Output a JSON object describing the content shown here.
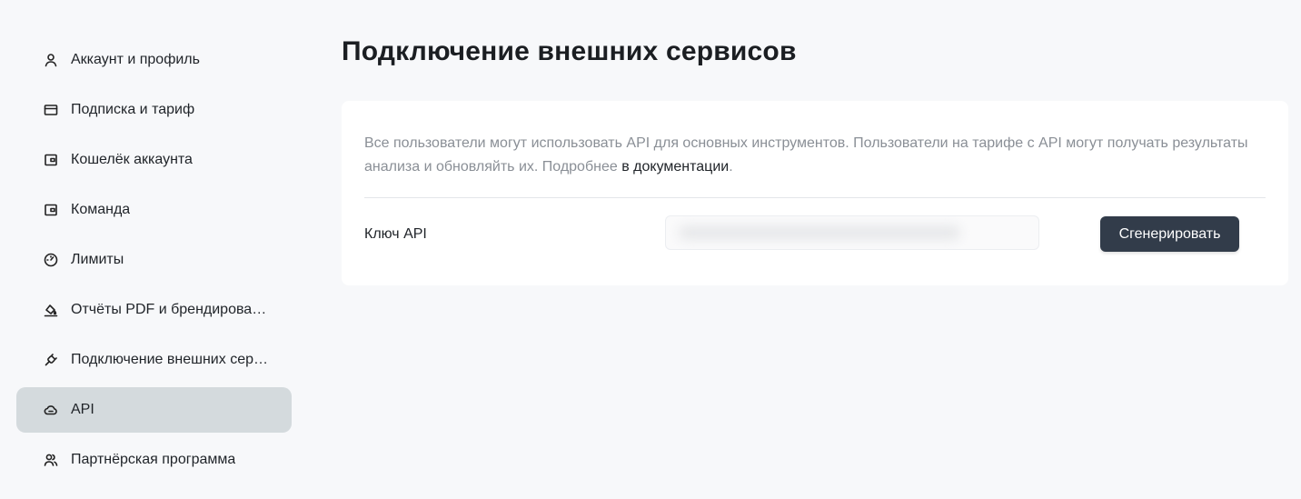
{
  "sidebar": {
    "items": [
      {
        "label": "Аккаунт и профиль",
        "icon": "user-icon",
        "active": false
      },
      {
        "label": "Подписка и тариф",
        "icon": "card-icon",
        "active": false
      },
      {
        "label": "Кошелёк аккаунта",
        "icon": "wallet-icon",
        "active": false
      },
      {
        "label": "Команда",
        "icon": "team-icon",
        "active": false
      },
      {
        "label": "Лимиты",
        "icon": "gauge-icon",
        "active": false
      },
      {
        "label": "Отчёты PDF и брендирова…",
        "icon": "paint-bucket-icon",
        "active": false
      },
      {
        "label": "Подключение внешних сер…",
        "icon": "plug-icon",
        "active": false
      },
      {
        "label": "API",
        "icon": "cloud-api-icon",
        "active": true
      },
      {
        "label": "Партнёрская программа",
        "icon": "partners-icon",
        "active": false
      }
    ]
  },
  "main": {
    "title": "Подключение внешних сервисов",
    "description": "Все пользователи могут использовать API для основных инструментов. Пользователи на тарифе с API могут получать результаты анализа и обновляйть их. Подробнее ",
    "doc_link": "в документации",
    "description_end": ".",
    "api_key_label": "Ключ API",
    "generate_button": "Сгенерировать"
  },
  "colors": {
    "active_nav_bg": "#d4dadd",
    "button_bg": "#323c4a",
    "page_bg": "#f7f8fa"
  }
}
